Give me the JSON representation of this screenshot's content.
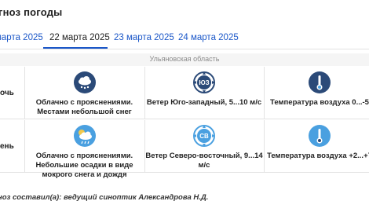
{
  "header": {
    "title": "гноз погоды"
  },
  "tabs": [
    {
      "label": "марта 2025"
    },
    {
      "label": "22 марта 2025"
    },
    {
      "label": "23 марта 2025"
    },
    {
      "label": "24 марта 2025"
    }
  ],
  "region": "Ульяновская область",
  "rows": [
    {
      "period": "очь",
      "cells": [
        {
          "icon": "cloud-snow-icon",
          "text": "Облачно с прояснениями. Местами небольшой снег"
        },
        {
          "icon": "wind-compass-icon",
          "badge": "ЮЗ",
          "text": "Ветер Юго-западный, 5...10 м/с"
        },
        {
          "icon": "thermometer-icon",
          "text": "Температура воздуха 0...-5"
        }
      ]
    },
    {
      "period": "ень",
      "cells": [
        {
          "icon": "sun-cloud-rain-icon",
          "text": "Облачно с прояснениями. Небольшие осадки в виде мокрого снега и дождя"
        },
        {
          "icon": "wind-compass-icon",
          "badge": "СВ",
          "text": "Ветер Северо-восточный, 9...14 м/с"
        },
        {
          "icon": "thermometer-icon",
          "text": "Температура воздуха +2...+7"
        }
      ]
    }
  ],
  "footer": "ноз составил(а): ведущий синоптик Александрова Н.Д.",
  "colors": {
    "accent": "#1a56c8",
    "icon_dark": "#2b4a78",
    "icon_light": "#4aa0e0"
  }
}
